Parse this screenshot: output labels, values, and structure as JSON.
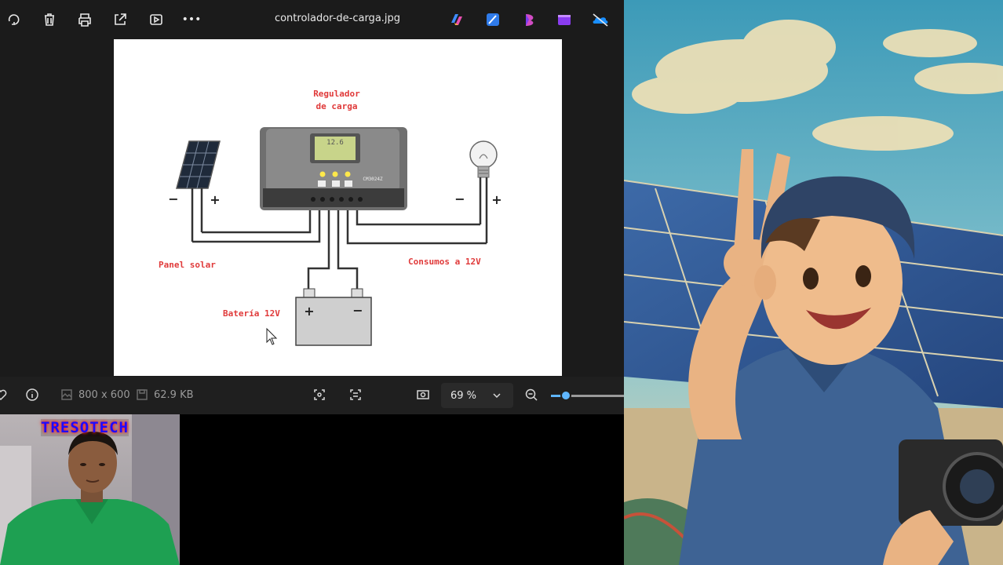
{
  "toolbar": {
    "filename": "controlador-de-carga.jpg",
    "more_label": "•••"
  },
  "diagram": {
    "regulator_line1": "Regulador",
    "regulator_line2": "de carga",
    "panel_label": "Panel solar",
    "loads_label": "Consumos a 12V",
    "battery_label": "Batería 12V",
    "lcd_value": "12.6",
    "model": "CM3024Z",
    "minus": "−",
    "plus": "+"
  },
  "statusbar": {
    "dimensions": "800 x 600",
    "filesize": "62.9 KB",
    "zoom": "69 %",
    "zoom_level": 0.2
  },
  "webcam": {
    "sign_text": "TRESOTECH"
  }
}
